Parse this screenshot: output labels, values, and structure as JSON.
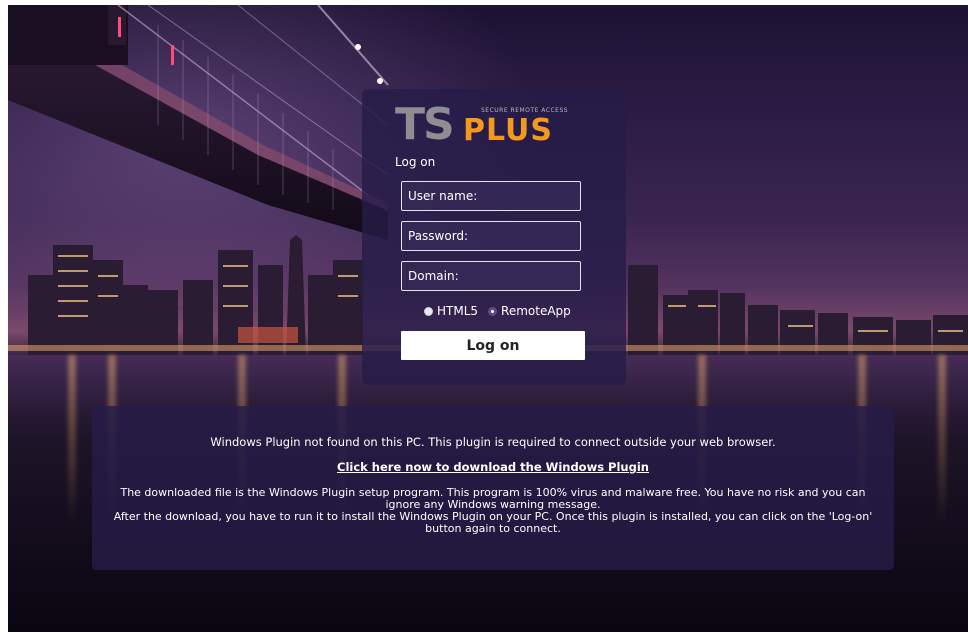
{
  "brand": {
    "logo_ts": "TS",
    "logo_plus": "PLUS",
    "tagline": "SECURE REMOTE ACCESS"
  },
  "login": {
    "caption": "Log on",
    "username_placeholder": "User name:",
    "password_placeholder": "Password:",
    "domain_placeholder": "Domain:",
    "options": [
      {
        "label": "HTML5",
        "selected": false
      },
      {
        "label": "RemoteApp",
        "selected": true
      }
    ],
    "submit_label": "Log on"
  },
  "notice": {
    "line1": "Windows Plugin not found on this PC. This plugin is required to connect outside your web browser.",
    "download_link": "Click here now to download the Windows Plugin",
    "para1": "The downloaded file is the Windows Plugin setup program. This program is 100% virus and malware free. You have no risk and you can ignore any Windows warning message.",
    "para2": "After the download, you have to run it to install the Windows Plugin on your PC. Once this plugin is installed, you can click on the 'Log-on' button again to connect."
  },
  "colors": {
    "panel_bg": "#261c48",
    "logo_orange": "#f39a1e",
    "logo_gray": "#8d8d92"
  }
}
